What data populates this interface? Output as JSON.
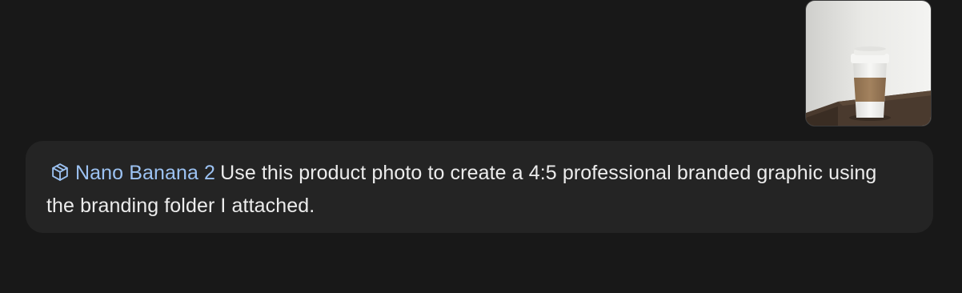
{
  "attachment": {
    "kind": "image",
    "depicts": "product photo of a coffee cup"
  },
  "message": {
    "tool": {
      "icon": "cube-icon",
      "label": "Nano Banana 2",
      "color": "#9cc2f2"
    },
    "text": "Use this product photo to create a 4:5 professional branded graphic using the branding folder I attached."
  },
  "colors": {
    "background": "#181818",
    "bubble": "#242424",
    "text": "#ececec"
  }
}
